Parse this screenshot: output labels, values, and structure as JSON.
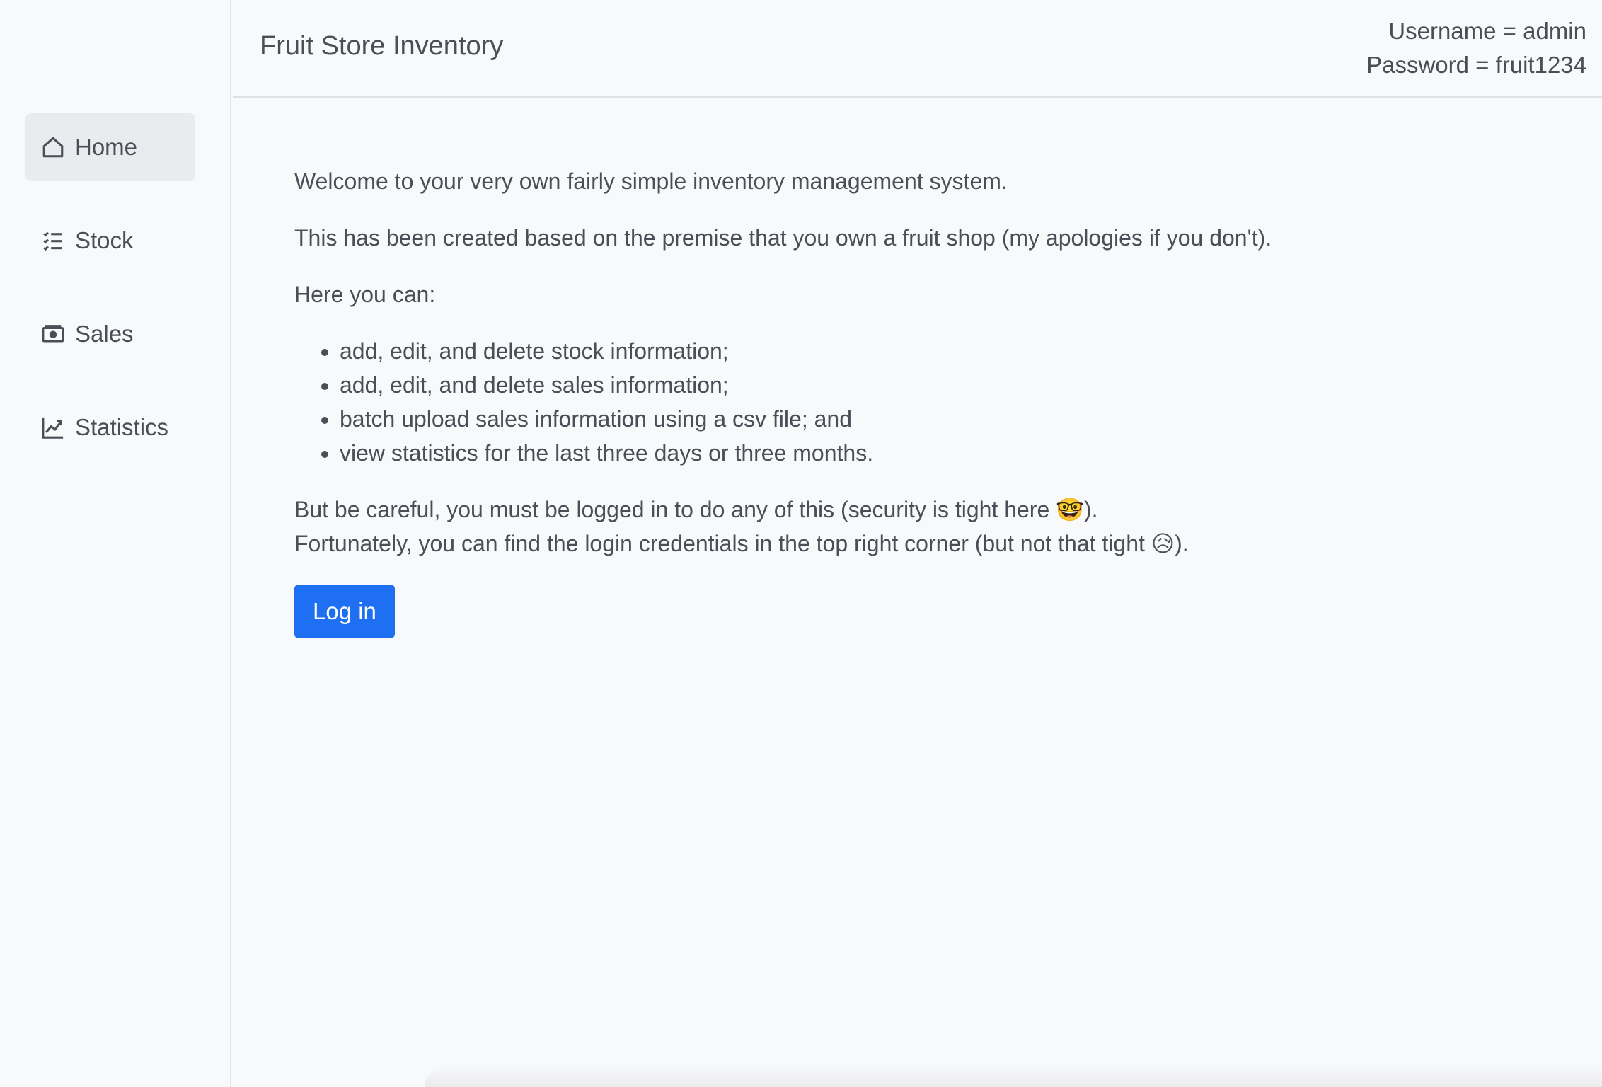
{
  "header": {
    "brand": "Fruit Store Inventory",
    "username_line": "Username = admin",
    "password_line": "Password = fruit1234"
  },
  "sidebar": {
    "items": [
      {
        "label": "Home",
        "icon": "home-icon",
        "active": true
      },
      {
        "label": "Stock",
        "icon": "list-check-icon",
        "active": false
      },
      {
        "label": "Sales",
        "icon": "cash-icon",
        "active": false
      },
      {
        "label": "Statistics",
        "icon": "graph-up-icon",
        "active": false
      }
    ]
  },
  "main": {
    "welcome": "Welcome to your very own fairly simple inventory management system.",
    "premise": "This has been created based on the premise that you own a fruit shop (my apologies if you don't).",
    "here_you_can": "Here you can:",
    "features": [
      "add, edit, and delete stock information;",
      "add, edit, and delete sales information;",
      "batch upload sales information using a csv file; and",
      "view statistics for the last three days or three months."
    ],
    "careful_before": "But be careful, you must be logged in to do any of this (security is tight here ",
    "careful_emoji": "🤓",
    "careful_after": ").",
    "fortunately_before": "Fortunately, you can find the login credentials in the top right corner (but not that tight ",
    "fortunately_emoji": "😥",
    "fortunately_after": ").",
    "login_button": "Log in"
  },
  "colors": {
    "primary": "#1f6ff2",
    "background": "#f8f9fb",
    "active_nav": "#e9ebee",
    "text": "#4a4f57"
  }
}
